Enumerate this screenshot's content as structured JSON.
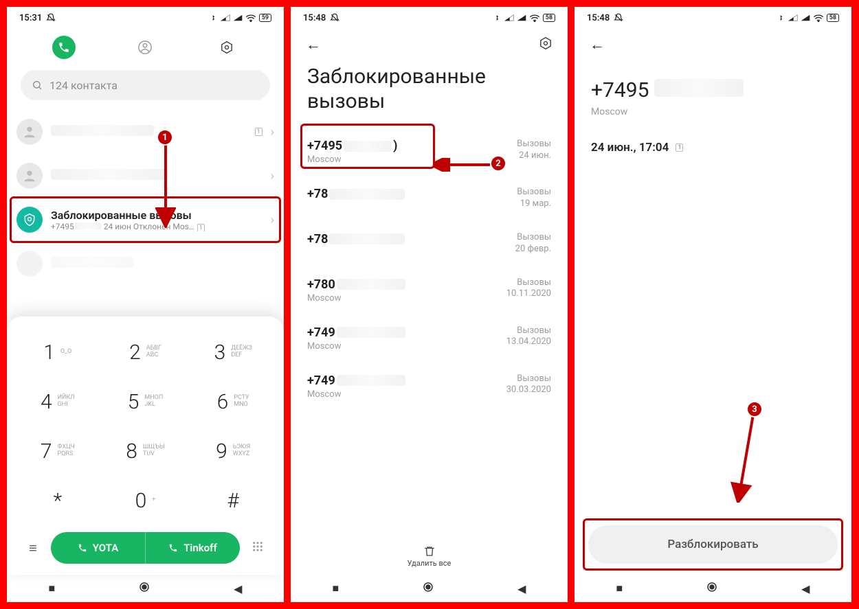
{
  "screen1": {
    "status": {
      "time": "15:31",
      "battery": "59"
    },
    "search_placeholder": "124 контакта",
    "blocked_row": {
      "title": "Заблокированные вызовы",
      "sub_prefix": "+7495",
      "sub_rest": "24 июн Отклонен  Mos…"
    },
    "dialpad": {
      "k1": {
        "n": "1",
        "l1": "О_О",
        "l2": ""
      },
      "k2": {
        "n": "2",
        "l1": "АБВГ",
        "l2": "ABC"
      },
      "k3": {
        "n": "3",
        "l1": "ДЕЁЖЗ",
        "l2": "DEF"
      },
      "k4": {
        "n": "4",
        "l1": "ИЙКЛ",
        "l2": "GHI"
      },
      "k5": {
        "n": "5",
        "l1": "МНОП",
        "l2": "JKL"
      },
      "k6": {
        "n": "6",
        "l1": "РСТУ",
        "l2": "MNO"
      },
      "k7": {
        "n": "7",
        "l1": "ФХЦЧ",
        "l2": "PQRS"
      },
      "k8": {
        "n": "8",
        "l1": "ШЩЪЫ",
        "l2": "TUV"
      },
      "k9": {
        "n": "9",
        "l1": "ЬЭЮЯ",
        "l2": "WXYZ"
      },
      "kstar": {
        "n": "*"
      },
      "k0": {
        "n": "0",
        "l1": "+"
      },
      "khash": {
        "n": "#"
      }
    },
    "call_btn1": "YOTA",
    "call_btn2": "Tinkoff"
  },
  "screen2": {
    "status": {
      "time": "15:48",
      "battery": "58"
    },
    "title": "Заблокированные вызовы",
    "items": [
      {
        "num_prefix": "+7495",
        "num_suffix": ")",
        "sub": "Moscow",
        "r1": "Вызовы",
        "r2": "24 июн."
      },
      {
        "num_prefix": "+78",
        "sub": "",
        "r1": "Вызовы",
        "r2": "19 мар."
      },
      {
        "num_prefix": "+78",
        "sub": "",
        "r1": "Вызовы",
        "r2": "20 февр."
      },
      {
        "num_prefix": "+780",
        "sub": "Moscow",
        "r1": "Вызовы",
        "r2": "10.11.2020"
      },
      {
        "num_prefix": "+749",
        "sub": "Moscow",
        "r1": "Вызовы",
        "r2": "13.04.2020"
      },
      {
        "num_prefix": "+749",
        "sub": "Moscow",
        "r1": "Вызовы",
        "r2": "30.03.2020"
      }
    ],
    "delete_all": "Удалить все"
  },
  "screen3": {
    "status": {
      "time": "15:48",
      "battery": "58"
    },
    "number_prefix": "+7495",
    "city": "Moscow",
    "log_entry": "24 июн., 17:04",
    "unblock": "Разблокировать"
  },
  "callouts": {
    "c1": "1",
    "c2": "2",
    "c3": "3"
  }
}
